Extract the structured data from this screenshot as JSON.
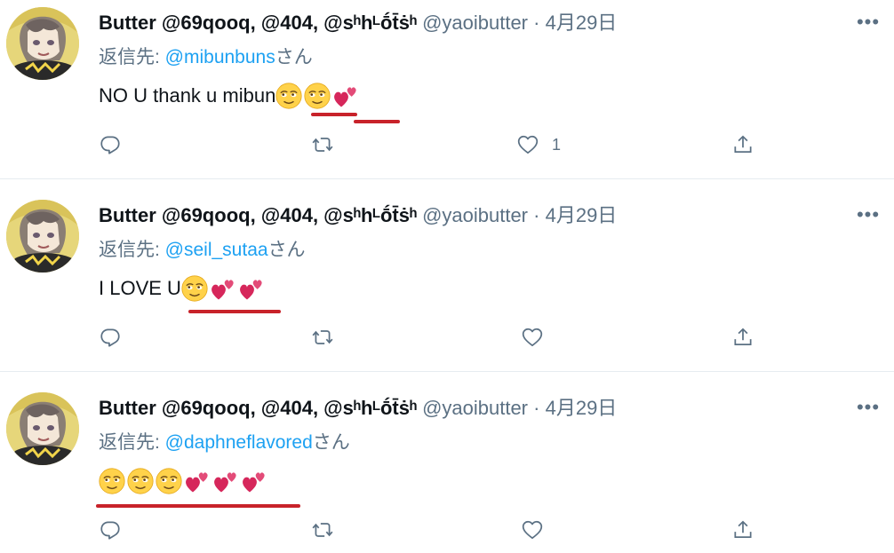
{
  "tweets": [
    {
      "author_name": "Butter @69qooq, @404, @sʰhᴸṓt̄ṡʰ",
      "handle": "@yaoibutter",
      "separator": "·",
      "date": "4月29日",
      "reply_prefix": "返信先: ",
      "reply_to": "@mibunbuns",
      "reply_suffix": "さん",
      "text": "NO U thank u mibun ",
      "emojis": [
        "smiling-face-with-rolling-eyes",
        "smiling-face-with-rolling-eyes",
        "two-hearts"
      ],
      "like_count": "1"
    },
    {
      "author_name": "Butter @69qooq, @404, @sʰhᴸṓt̄ṡʰ",
      "handle": "@yaoibutter",
      "separator": "·",
      "date": "4月29日",
      "reply_prefix": "返信先: ",
      "reply_to": "@seil_sutaa",
      "reply_suffix": "さん",
      "text": "I LOVE U ",
      "emojis": [
        "smiling-face-with-rolling-eyes",
        "two-hearts",
        "two-hearts"
      ],
      "like_count": ""
    },
    {
      "author_name": "Butter @69qooq, @404, @sʰhᴸṓt̄ṡʰ",
      "handle": "@yaoibutter",
      "separator": "·",
      "date": "4月29日",
      "reply_prefix": "返信先: ",
      "reply_to": "@daphneflavored",
      "reply_suffix": "さん",
      "text": "",
      "emojis": [
        "smiling-face-with-rolling-eyes",
        "smiling-face-with-rolling-eyes",
        "smiling-face-with-rolling-eyes",
        "two-hearts",
        "two-hearts",
        "two-hearts"
      ],
      "like_count": ""
    }
  ],
  "more_label": "•••",
  "icons": {
    "reply": "reply-icon",
    "retweet": "retweet-icon",
    "like": "heart-icon",
    "share": "share-icon"
  },
  "annotation_color": "#c8222a",
  "link_color": "#1da1f2",
  "muted_color": "#5b7083"
}
